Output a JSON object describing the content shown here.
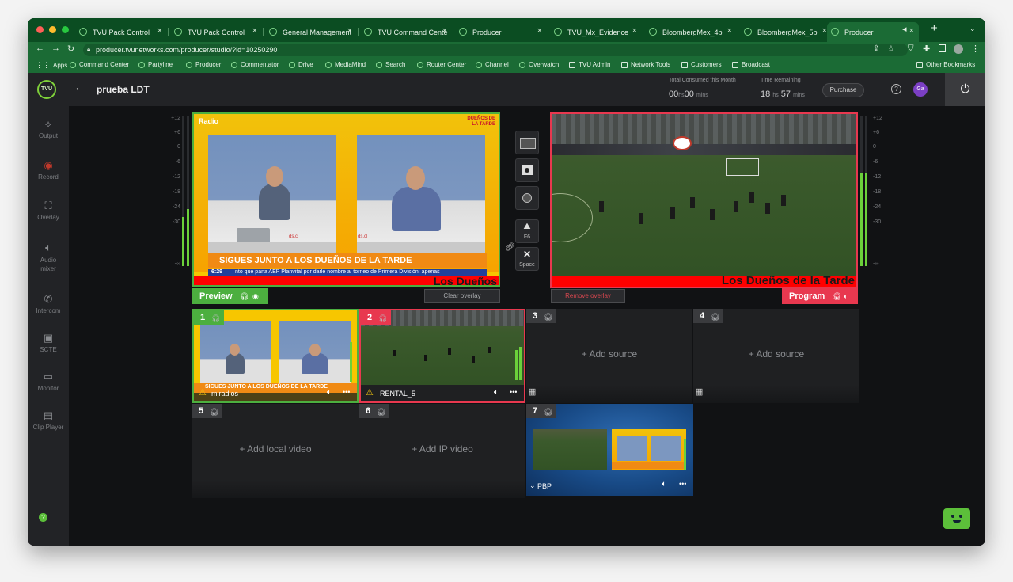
{
  "browser": {
    "tabs": [
      "TVU Pack Control",
      "TVU Pack Control",
      "General Management",
      "TVU Command Cente",
      "Producer",
      "TVU_Mx_Evidence",
      "BloombergMex_4b",
      "BloombergMex_5b",
      "Producer"
    ],
    "new_tab": "+",
    "url": "producer.tvunetworks.com/producer/studio/?id=10250290",
    "bookmarks": [
      "Apps",
      "Command Center",
      "Partyline",
      "Producer",
      "Commentator",
      "Drive",
      "MediaMind",
      "Search",
      "Router Center",
      "Channel",
      "Overwatch",
      "TVU Admin",
      "Network Tools",
      "Customers",
      "Broadcast"
    ],
    "other_bookmarks": "Other Bookmarks"
  },
  "app": {
    "logo": "TVU",
    "back": "←",
    "title": "prueba LDT",
    "consumed_label": "Total Consumed this Month",
    "consumed_hrs": "00",
    "consumed_mins": "00",
    "remaining_label": "Time Remaining",
    "remaining_hrs": "18",
    "remaining_mins": "57",
    "hs": "hs",
    "mins": "mins",
    "purchase": "Purchase",
    "avatar": "Ga"
  },
  "sidebar": [
    {
      "label": "Output",
      "icon": "output-icon"
    },
    {
      "label": "Record",
      "icon": "record-icon"
    },
    {
      "label": "Overlay",
      "icon": "overlay-icon"
    },
    {
      "label": "Audio mixer",
      "icon": "audio-icon"
    },
    {
      "label": "Intercom",
      "icon": "phone-icon"
    },
    {
      "label": "SCTE",
      "icon": "scte-icon"
    },
    {
      "label": "Monitor",
      "icon": "monitor-icon"
    },
    {
      "label": "Clip Player",
      "icon": "clip-icon"
    }
  ],
  "meter_scale": [
    "+12",
    "+6",
    "0",
    "-6",
    "-12",
    "-18",
    "-24",
    "-30",
    "-∞"
  ],
  "preview": {
    "label": "Preview",
    "clear_overlay": "Clear overlay",
    "brand": "Radio",
    "show": "DUEÑOS DE LA TARDE",
    "banner": "SIGUES JUNTO A LOS DUEÑOS DE LA TARDE",
    "time": "6:29",
    "ticker": "nto que pana AEP Planvital por darle nombre al torneo de Primera División: apenas",
    "overlay_text": "Los Dueños",
    "watermark": "ds.cl"
  },
  "program": {
    "label": "Program",
    "remove_overlay": "Remove overlay",
    "overlay_text": "Los Dueños de la Tarde"
  },
  "transitions": [
    {
      "icon": "cut-icon",
      "key": ""
    },
    {
      "icon": "fade-icon",
      "key": ""
    },
    {
      "icon": "wipe-icon",
      "key": ""
    },
    {
      "icon": "image-icon",
      "key": "F6"
    },
    {
      "icon": "swap-icon",
      "key": "Space"
    }
  ],
  "sources": [
    {
      "num": "1",
      "name": "miradios",
      "status": "preview"
    },
    {
      "num": "2",
      "name": "RENTAL_5",
      "status": "program"
    },
    {
      "num": "3",
      "name": "+ Add source",
      "status": "empty"
    },
    {
      "num": "4",
      "name": "+ Add source",
      "status": "empty"
    },
    {
      "num": "5",
      "name": "+ Add local video",
      "status": "empty"
    },
    {
      "num": "6",
      "name": "+ Add IP video",
      "status": "empty"
    },
    {
      "num": "7",
      "name": "PBP",
      "status": "multi"
    }
  ],
  "source1_banner": "SIGUES JUNTO A LOS DUEÑOS DE LA TARDE",
  "more": "•••",
  "help": "?",
  "colors": {
    "preview": "#4caf3f",
    "program": "#e8384f",
    "chrome": "#0b4d22"
  }
}
